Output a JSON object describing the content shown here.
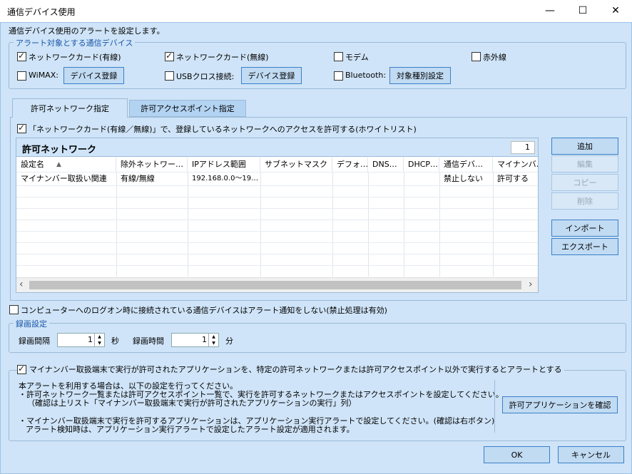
{
  "window": {
    "title": "通信デバイス使用",
    "minimize_glyph": "—",
    "maximize_glyph": "☐",
    "close_glyph": "✕"
  },
  "description": "通信デバイス使用のアラートを設定します。",
  "device_group": {
    "legend": "アラート対象とする通信デバイス",
    "wired": "ネットワークカード(有線)",
    "wireless": "ネットワークカード(無線)",
    "modem": "モデム",
    "infrared": "赤外線",
    "wimax": "WiMAX:",
    "wimax_button": "デバイス登録",
    "usb": "USBクロス接続:",
    "usb_button": "デバイス登録",
    "bluetooth": "Bluetooth:",
    "bluetooth_button": "対象種別設定"
  },
  "tabs": [
    {
      "label": "許可ネットワーク指定",
      "active": true
    },
    {
      "label": "許可アクセスポイント指定",
      "active": false
    }
  ],
  "whitelist_label": "「ネットワークカード(有線／無線)」で、登録しているネットワークへのアクセスを許可する(ホワイトリスト)",
  "grid": {
    "title": "許可ネットワーク",
    "count": "1",
    "sort_glyph": "▲",
    "columns": [
      "設定名",
      "除外ネットワー…",
      "IPアドレス範囲",
      "サブネットマスク",
      "デフォ…",
      "DNS…",
      "DHCP…",
      "通信デバ…",
      "マイナンバ…"
    ],
    "rows": [
      [
        "マイナンバー取扱い関連",
        "有線/無線",
        "192.168.0.0～19…",
        "",
        "",
        "",
        "",
        "禁止しない",
        "許可する"
      ]
    ],
    "scroll_left": "‹",
    "scroll_right": "›"
  },
  "side_buttons": {
    "add": "追加",
    "edit": "編集",
    "copy": "コピー",
    "delete": "削除",
    "import": "インポート",
    "export": "エクスポート"
  },
  "logon_label": "コンピューターへのログオン時に接続されている通信デバイスはアラート通知をしない(禁止処理は有効)",
  "recording": {
    "legend": "録画設定",
    "interval_label": "録画間隔",
    "interval_value": "1",
    "interval_unit": "秒",
    "duration_label": "録画時間",
    "duration_value": "1",
    "duration_unit": "分"
  },
  "mynumber": {
    "label": "マイナンバー取扱端末で実行が許可されたアプリケーションを、特定の許可ネットワークまたは許可アクセスポイント以外で実行するとアラートとする",
    "line1": "本アラートを利用する場合は、以下の設定を行ってください。",
    "line2": "・許可ネットワーク一覧または許可アクセスポイント一覧で、実行を許可するネットワークまたはアクセスポイントを設定してください。",
    "line3": "（確認は上リスト「マイナンバー取扱端末で実行が許可されたアプリケーションの実行」列）",
    "line4": "・マイナンバー取扱端末で実行を許可するアプリケーションは、アプリケーション実行アラートで設定してください。(確認は右ボタン)",
    "line5": "アラート検知時は、アプリケーション実行アラートで設定したアラート設定が適用されます。",
    "confirm_button": "許可アプリケーションを確認"
  },
  "footer": {
    "ok": "OK",
    "cancel": "キャンセル"
  }
}
